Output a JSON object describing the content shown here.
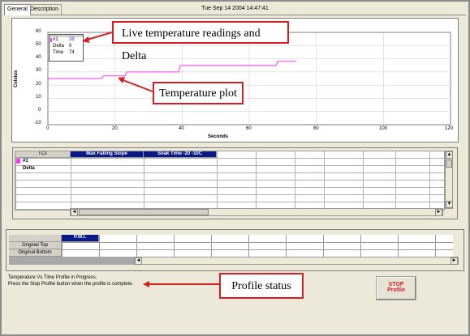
{
  "tabs": [
    {
      "label": "General",
      "active": true
    },
    {
      "label": "Description",
      "active": false
    }
  ],
  "datetime": "Tue Sep 14 2004 14:47:41",
  "chart": {
    "ylabel": "Celsius",
    "xlabel": "Seconds",
    "yticks": [
      "60",
      "50",
      "40",
      "30",
      "20",
      "10",
      "0",
      "-10"
    ],
    "xticks": [
      "0",
      "20",
      "40",
      "60",
      "80",
      "100",
      "120"
    ],
    "series_color": "#ff33ff"
  },
  "chart_data": {
    "type": "line",
    "xlabel": "Seconds",
    "ylabel": "Celsius",
    "xlim": [
      0,
      120
    ],
    "ylim": [
      -10,
      60
    ],
    "series": [
      {
        "name": "#1",
        "color": "#ff33ff",
        "x": [
          0,
          16,
          16.5,
          23,
          23.5,
          39,
          39.5,
          68,
          68.5,
          74
        ],
        "y": [
          25,
          25,
          27,
          27,
          30,
          30,
          35,
          35,
          38,
          38
        ]
      }
    ]
  },
  "readout": {
    "series_label": "#1",
    "series_value": "38",
    "delta_label": "Delta",
    "delta_value": "0",
    "time_label": "Time",
    "time_value": "74"
  },
  "callouts": {
    "live": "Live temperature readings and Delta",
    "plot": "Temperature plot",
    "status": "Profile status"
  },
  "tc_table": {
    "col0_header": "TCs",
    "headers": [
      "Max Falling Slope",
      "Soak Time -20 -10C"
    ],
    "rows": [
      "#1",
      "Delta"
    ],
    "row_color": "#ff33ff"
  },
  "pwi_table": {
    "header": "P.W.I.",
    "rows": [
      "Original Top",
      "Original Bottom"
    ]
  },
  "status": {
    "line1": "Temperature Vs Time Profile in Progress.",
    "line2": "Press the Stop Profile button when the profile is complete."
  },
  "stop_button": {
    "line1": "STOP",
    "line2": "Profile"
  }
}
